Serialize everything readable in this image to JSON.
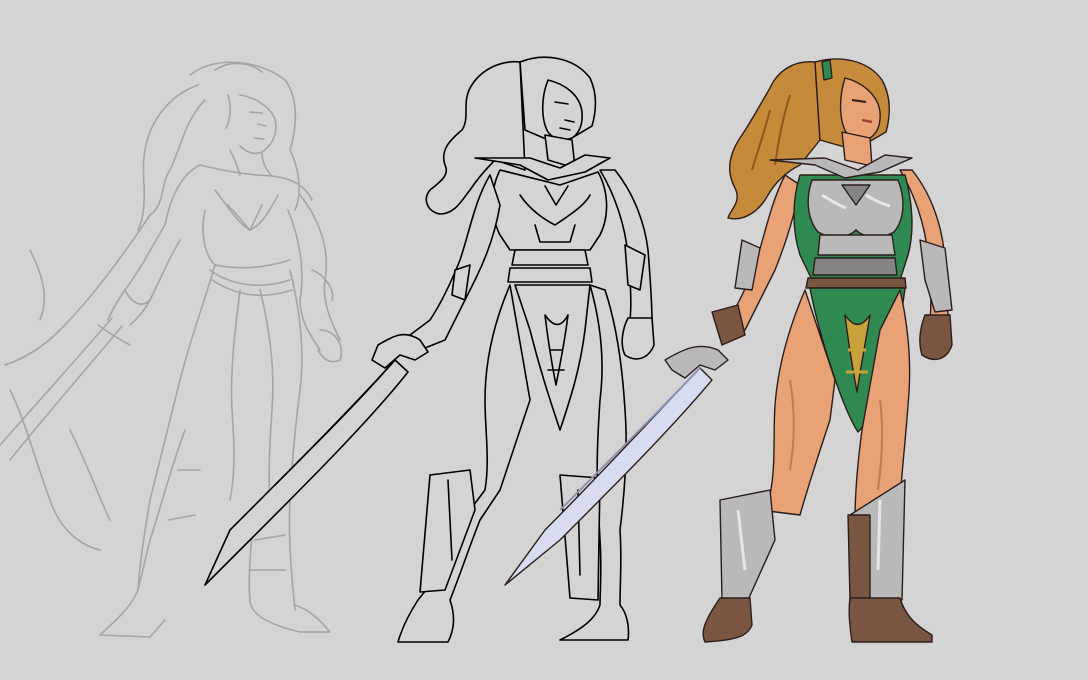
{
  "canvas": {
    "background": "#d4d4d4"
  },
  "stages": [
    {
      "id": "sketch",
      "style": "rough pencil sketch",
      "stroke": "#9a9a9a",
      "opacity": 0.75
    },
    {
      "id": "lineart",
      "style": "clean pixel line art",
      "stroke": "#000000"
    },
    {
      "id": "colored",
      "style": "colored pixel art sprite"
    }
  ],
  "palette": {
    "hair": "#c58a3a",
    "hair_shadow": "#8a5a20",
    "skin": "#e8a276",
    "skin_shadow": "#c47a52",
    "armor": "#b9b9b9",
    "armor_shadow": "#858585",
    "armor_highlight": "#e6e6e6",
    "tunic_green": "#2f8a52",
    "emblem_gold": "#c9a23b",
    "boots_brown": "#7a5642",
    "blade_light": "#d8dcf0",
    "blade_shadow": "#8d93b3",
    "outline": "#2b1e1a"
  }
}
